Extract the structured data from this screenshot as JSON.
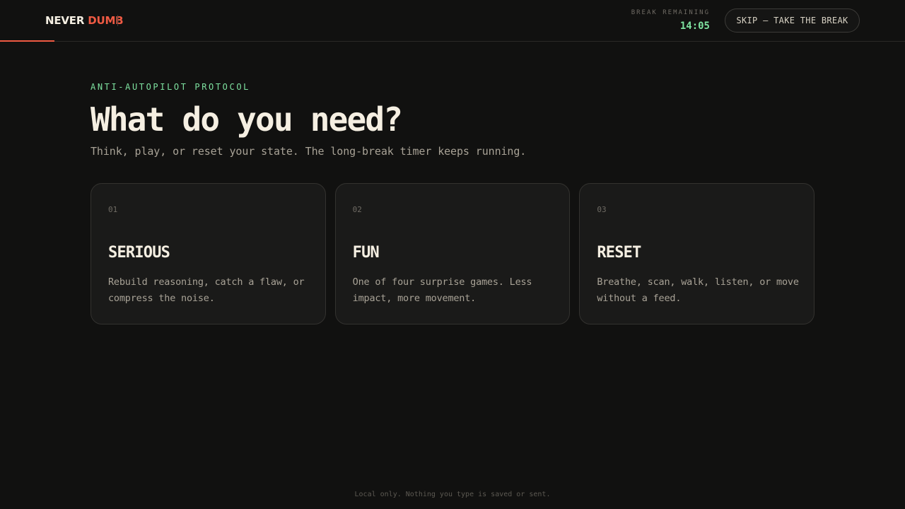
{
  "header": {
    "brand_first": "NEVER",
    "brand_second": "DUMB",
    "timer_label": "BREAK REMAINING",
    "timer_value": "14:05",
    "skip_label": "SKIP — TAKE THE BREAK",
    "progress_fraction": 0.06
  },
  "main": {
    "eyebrow": "ANTI-AUTOPILOT PROTOCOL",
    "title": "What do you need?",
    "subtitle": "Think, play, or reset your state. The long-break timer keeps running."
  },
  "cards": [
    {
      "number": "01",
      "title": "SERIOUS",
      "description": "Rebuild reasoning, catch a flaw, or compress the noise."
    },
    {
      "number": "02",
      "title": "FUN",
      "description": "One of four surprise games. Less impact, more movement."
    },
    {
      "number": "03",
      "title": "RESET",
      "description": "Breathe, scan, walk, listen, or move without a feed."
    }
  ],
  "footer": {
    "note": "Local only. Nothing you type is saved or sent."
  },
  "colors": {
    "accent": "#ef5a43",
    "success": "#7ee2a0",
    "background": "#111110"
  }
}
